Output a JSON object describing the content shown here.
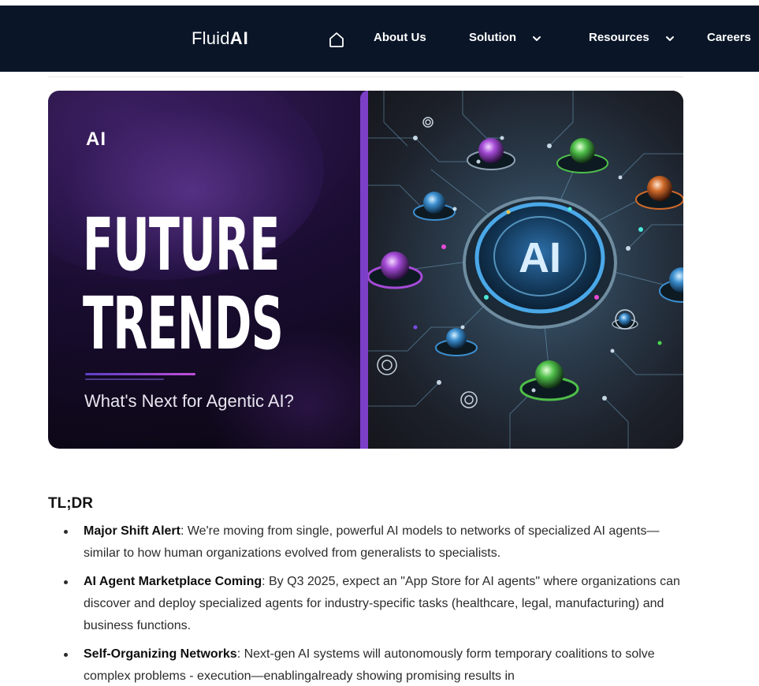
{
  "nav": {
    "brand_prefix": "Fluid ",
    "brand_suffix": "AI",
    "icons": {
      "home": "home-icon",
      "caret": "chevron-down-icon"
    },
    "items": [
      {
        "label": "About Us"
      },
      {
        "label": "Solution"
      },
      {
        "label": "Resources"
      },
      {
        "label": "Careers"
      }
    ]
  },
  "hero": {
    "logo": "AI",
    "title_line1": "FUTURE",
    "title_line2": "TRENDS",
    "subtitle": "What's Next for Agentic AI?",
    "badge": "AI"
  },
  "article": {
    "heading": "TL;DR",
    "bullets": [
      {
        "term": "Major Shift Alert",
        "text": ": We're moving from single, powerful AI models to networks of specialized AI agents—similar to how human organizations evolved from generalists to specialists."
      },
      {
        "term": "AI Agent Marketplace Coming",
        "text": ": By Q3 2025, expect an \"App Store for AI agents\" where organizations can discover and deploy specialized agents for industry-specific tasks (healthcare, legal, manufacturing) and business functions."
      },
      {
        "term": "Self-Organizing Networks",
        "text": ": Next-gen AI systems will autonomously form temporary coalitions to solve complex problems - execution—enablingalready showing promising results in"
      }
    ]
  },
  "colors": {
    "nav_bg": "#0a1628",
    "hero_frame": "#7b3fc8",
    "hero_dark": "#1b0d33"
  }
}
